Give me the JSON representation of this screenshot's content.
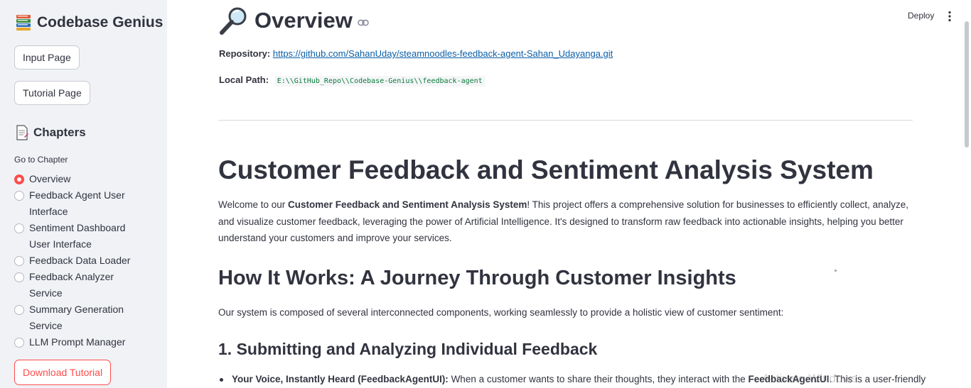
{
  "sidebar": {
    "app_title": "Codebase Genius",
    "input_page_button": "Input Page",
    "tutorial_page_button": "Tutorial Page",
    "chapters_heading": "Chapters",
    "goto_label": "Go to Chapter",
    "chapters": [
      {
        "label": "Overview",
        "selected": true
      },
      {
        "label": "Feedback Agent User Interface",
        "selected": false
      },
      {
        "label": "Sentiment Dashboard User Interface",
        "selected": false
      },
      {
        "label": "Feedback Data Loader",
        "selected": false
      },
      {
        "label": "Feedback Analyzer Service",
        "selected": false
      },
      {
        "label": "Summary Generation Service",
        "selected": false
      },
      {
        "label": "LLM Prompt Manager",
        "selected": false
      }
    ],
    "download_button": "Download Tutorial"
  },
  "header": {
    "deploy_label": "Deploy"
  },
  "main": {
    "title": "Overview",
    "repository_label": "Repository:",
    "repository_url": "https://github.com/SahanUday/steamnoodles-feedback-agent-Sahan_Udayanga.git",
    "local_path_label": "Local Path:",
    "local_path_value": "E:\\\\GitHub_Repo\\\\Codebase-Genius\\\\feedback-agent",
    "h1": "Customer Feedback and Sentiment Analysis System",
    "intro_pre": "Welcome to our ",
    "intro_bold": "Customer Feedback and Sentiment Analysis System",
    "intro_post": "! This project offers a comprehensive solution for businesses to efficiently collect, analyze, and visualize customer feedback, leveraging the power of Artificial Intelligence. It's designed to transform raw feedback into actionable insights, helping you better understand your customers and improve your services.",
    "h2": "How It Works: A Journey Through Customer Insights",
    "h2_para": "Our system is composed of several interconnected components, working seamlessly to provide a holistic view of customer sentiment:",
    "h3": "1. Submitting and Analyzing Individual Feedback",
    "bullet_bold": "Your Voice, Instantly Heard (FeedbackAgentUI):",
    "bullet_text": " When a customer wants to share their thoughts, they interact with the ",
    "bullet_bold2": "FeedbackAgentUI",
    "bullet_tail": ". This is a user-friendly"
  },
  "overlay": {
    "watermark": "Activate Windows"
  },
  "colors": {
    "accent": "#ff4b4b",
    "link": "#0b5ea8",
    "sidebar_bg": "#f0f2f6"
  }
}
